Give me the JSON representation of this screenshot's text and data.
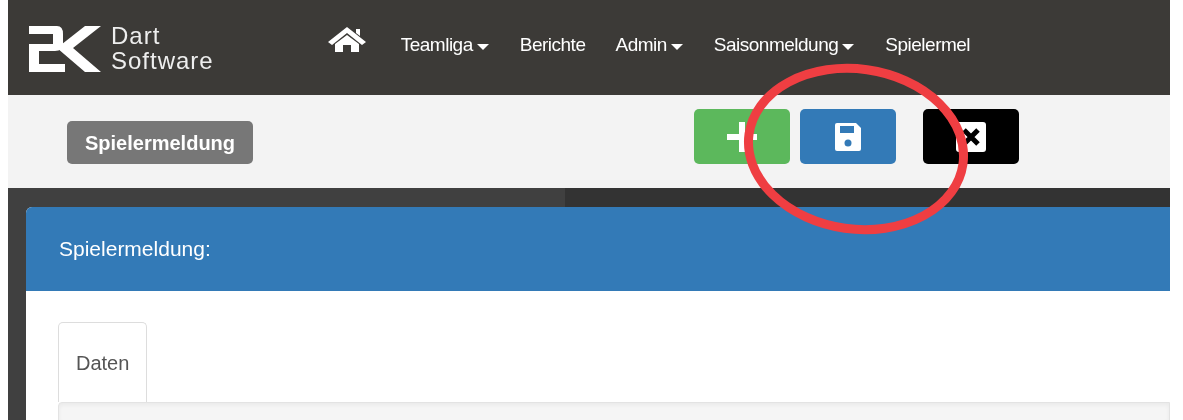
{
  "navbar": {
    "logo": {
      "lines": [
        "Dart",
        "Software"
      ]
    },
    "items": [
      {
        "kind": "home"
      },
      {
        "kind": "link",
        "label": "Teamliga",
        "dropdown": true
      },
      {
        "kind": "link",
        "label": "Berichte",
        "dropdown": false
      },
      {
        "kind": "link",
        "label": "Admin",
        "dropdown": true
      },
      {
        "kind": "link",
        "label": "Saisonmeldung",
        "dropdown": true
      },
      {
        "kind": "link",
        "label": "Spielermel",
        "dropdown": false
      }
    ]
  },
  "toolbar": {
    "badge": "Spielermeldung",
    "buttons": [
      {
        "kind": "add"
      },
      {
        "kind": "save"
      },
      {
        "kind": "close"
      }
    ]
  },
  "panel": {
    "title": "Spielermeldung:",
    "tabs": [
      {
        "label": "Daten",
        "selected": true
      }
    ]
  }
}
